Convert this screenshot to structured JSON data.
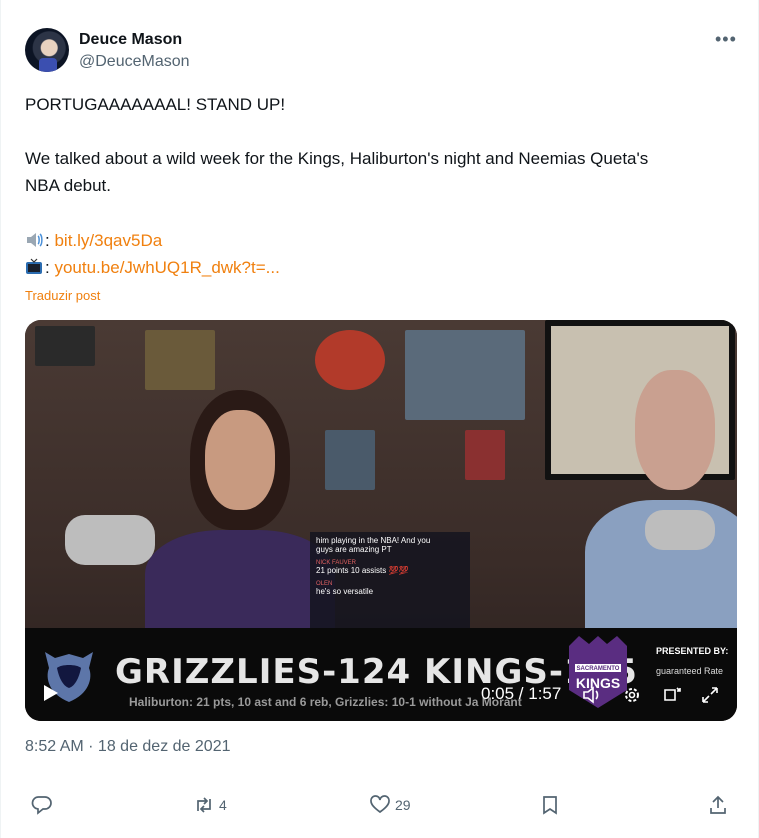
{
  "author": {
    "name": "Deuce Mason",
    "handle": "@DeuceMason"
  },
  "tweet": {
    "line1": "PORTUGAAAAAAAL! STAND UP!",
    "line2": "We talked about a wild week for the Kings, Haliburton's night and Neemias Queta's",
    "line3": "NBA debut.",
    "audio_link": "bit.ly/3qav5Da",
    "video_link": "youtu.be/JwhUQ1R_dwk?t=...",
    "colon": ":",
    "translate": "Traduzir post"
  },
  "media": {
    "score_text": "GRIZZLIES-124 KINGS-105",
    "sub_text": "Haliburton: 21 pts, 10 ast and 6 reb, Grizzlies: 10-1 without Ja Morant",
    "presented_by": "PRESENTED BY:",
    "sponsor": "guaranteed Rate",
    "kings_top": "SACRAMENTO",
    "kings_word": "KINGS",
    "chat_line1": "him playing in the NBA! And you",
    "chat_line2": "guys are amazing PT",
    "chat_user1": "NICK FAUVER",
    "chat_line3": "21 points 10 assists 💯💯",
    "chat_user2": "OLEN",
    "chat_line4": "he's so versatile",
    "time": "0:05 / 1:57"
  },
  "meta": {
    "timestamp": "8:52 AM · 18 de dez de 2021"
  },
  "stats": {
    "retweets": "4",
    "likes": "29"
  },
  "colors": {
    "accent": "#f0800f",
    "muted": "#536471"
  }
}
